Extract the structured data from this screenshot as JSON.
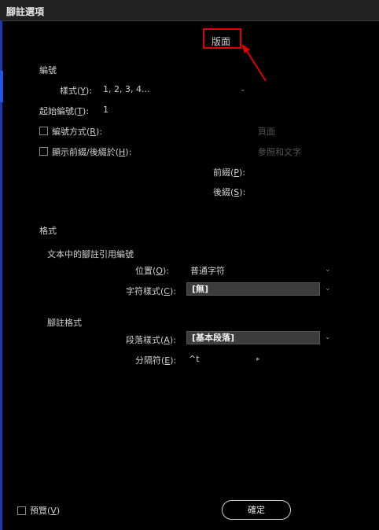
{
  "window": {
    "title": "腳註選項"
  },
  "tabs": {
    "layout": "版面"
  },
  "numbering": {
    "section_title": "編號",
    "style_label_pre": "樣式(",
    "style_key": "Y",
    "style_label_post": "):",
    "style_value": "1, 2, 3, 4...",
    "start_label_pre": "起始編號(",
    "start_key": "T",
    "start_label_post": "):",
    "start_value": "1",
    "restart_label_pre": "編號方式(",
    "restart_key": "R",
    "restart_label_post": "):",
    "restart_value": "頁面",
    "prefix_suffix_label_pre": "顯示前綴/後綴於(",
    "prefix_suffix_key": "H",
    "prefix_suffix_label_post": "):",
    "prefix_suffix_value": "參照和文字",
    "prefix_label_pre": "前綴(",
    "prefix_key": "P",
    "prefix_label_post": "):",
    "suffix_label_pre": "後綴(",
    "suffix_key": "S",
    "suffix_label_post": "):"
  },
  "formatting": {
    "section_title": "格式",
    "ref_subtitle": "文本中的腳註引用編號",
    "position_label_pre": "位置(",
    "position_key": "O",
    "position_label_post": "):",
    "position_value": "普通字符",
    "char_style_label_pre": "字符樣式(",
    "char_style_key": "C",
    "char_style_label_post": "):",
    "char_style_value": "[無]",
    "footnote_subtitle": "腳註格式",
    "para_style_label_pre": "段落樣式(",
    "para_style_key": "A",
    "para_style_label_post": "):",
    "para_style_value": "[基本段落]",
    "separator_label_pre": "分隔符(",
    "separator_key": "E",
    "separator_label_post": "):",
    "separator_value": "^t"
  },
  "footer": {
    "preview_label_pre": "預覽(",
    "preview_key": "V",
    "preview_label_post": ")",
    "ok_label": "確定"
  },
  "colors": {
    "highlight": "#e00000",
    "accent": "#2a55d4"
  }
}
